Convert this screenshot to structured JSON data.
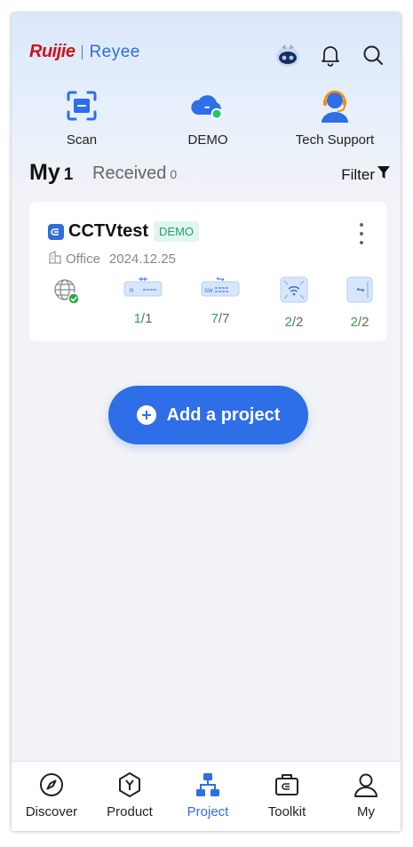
{
  "brand": {
    "primary": "Ruijie",
    "secondary": "Reyee",
    "accent": "#2e6ee6",
    "red": "#d0111b"
  },
  "topbar": {
    "icons": [
      "assistant-robot-icon",
      "bell-icon",
      "search-icon"
    ]
  },
  "quick_actions": [
    {
      "label": "Scan",
      "icon": "scan-icon"
    },
    {
      "label": "DEMO",
      "icon": "cloud-icon"
    },
    {
      "label": "Tech Support",
      "icon": "headset-agent-icon"
    }
  ],
  "tabs": {
    "my_label": "My",
    "my_count": "1",
    "received_label": "Received",
    "received_count": "0",
    "filter_label": "Filter"
  },
  "project": {
    "name": "CCTVtest",
    "badge": "DEMO",
    "type": "Office",
    "date": "2024.12.25",
    "status_color": "#2aa845",
    "devices": [
      {
        "icon": "internet-globe-icon",
        "online": null,
        "total": null
      },
      {
        "icon": "router-icon",
        "label": "R",
        "online": "1",
        "total": "1"
      },
      {
        "icon": "switch-icon",
        "label": "SW",
        "online": "7",
        "total": "7"
      },
      {
        "icon": "access-point-icon",
        "online": "2",
        "total": "2"
      },
      {
        "icon": "bridge-icon",
        "online": "2",
        "total": "2"
      }
    ]
  },
  "add_project": {
    "label": "Add a project"
  },
  "bottom_nav": [
    {
      "label": "Discover",
      "icon": "compass-icon"
    },
    {
      "label": "Product",
      "icon": "hexagon-y-icon"
    },
    {
      "label": "Project",
      "icon": "topology-icon",
      "active": true
    },
    {
      "label": "Toolkit",
      "icon": "toolbox-icon"
    },
    {
      "label": "My",
      "icon": "user-icon"
    }
  ]
}
